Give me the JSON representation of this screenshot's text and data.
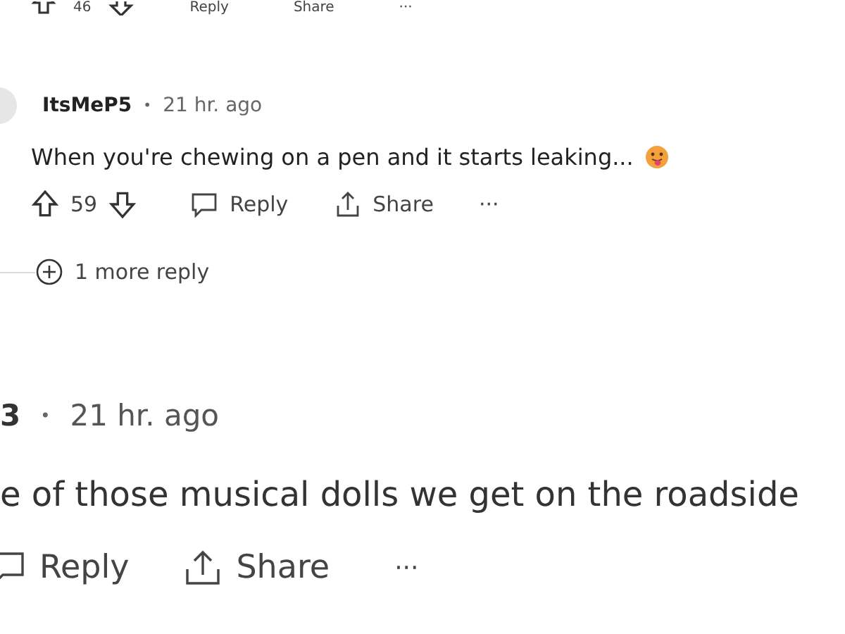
{
  "top_actions": {
    "votes": "46",
    "reply": "Reply",
    "share": "Share",
    "more": "···"
  },
  "reply_comment": {
    "username": "ItsMeP5",
    "separator": "•",
    "time": "21 hr. ago",
    "body": "When you're chewing on a pen and it starts leaking...",
    "votes": "59",
    "reply": "Reply",
    "share": "Share",
    "more": "···",
    "more_replies": "1 more reply"
  },
  "next_comment": {
    "username": "3",
    "separator": "•",
    "time": "21 hr. ago",
    "body": "e of those musical dolls we get on the roadside",
    "reply": "Reply",
    "share": "Share",
    "more": "···"
  }
}
